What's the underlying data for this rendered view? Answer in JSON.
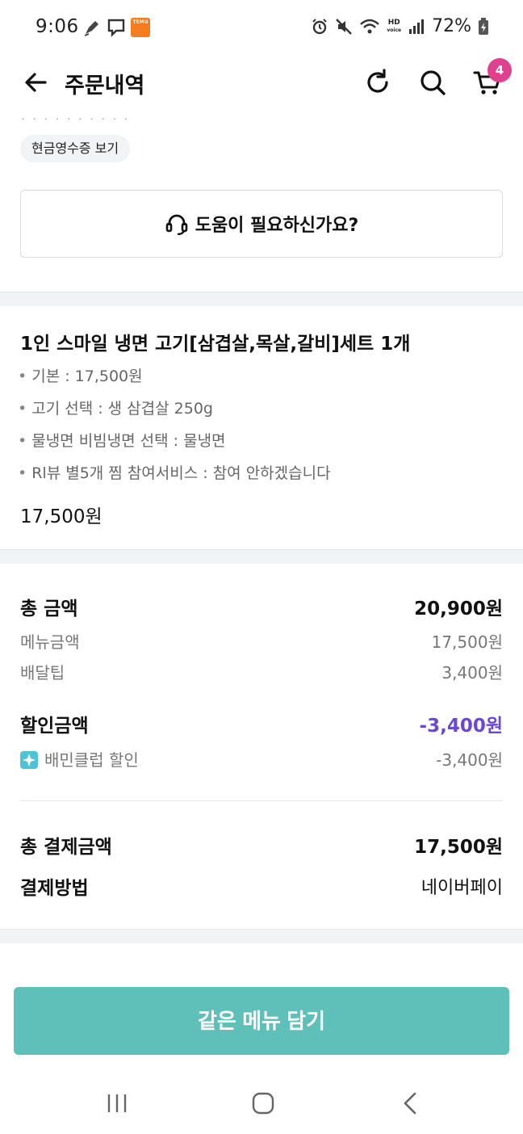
{
  "status_bar": {
    "time": "9:06",
    "battery": "72%",
    "hd_label": "HD",
    "voice_label": "voice",
    "temu_label": "TEMU"
  },
  "header": {
    "title": "주문내역",
    "cart_count": "4"
  },
  "receipt_button": "현금영수증 보기",
  "help_button": "도움이 필요하신가요?",
  "menu": {
    "title": "1인 스마일 냉면 고기[삼겹살,목살,갈비]세트 1개",
    "options": [
      "기본 : 17,500원",
      "고기 선택 : 생 삼겹살 250g",
      "물냉면 비빔냉면 선택 : 물냉면",
      "Rl뷰 별5개 찜 참여서비스 : 참여 안하겠습니다"
    ],
    "price": "17,500원"
  },
  "payment": {
    "total_label": "총 금액",
    "total_value": "20,900원",
    "menu_amount_label": "메뉴금액",
    "menu_amount_value": "17,500원",
    "delivery_tip_label": "배달팁",
    "delivery_tip_value": "3,400원",
    "discount_label": "할인금액",
    "discount_value": "-3,400원",
    "club_discount_label": "배민클럽 할인",
    "club_discount_value": "-3,400원",
    "final_label": "총 결제금액",
    "final_value": "17,500원",
    "method_label": "결제방법",
    "method_value": "네이버페이"
  },
  "cta": "같은 메뉴 담기",
  "colors": {
    "accent": "#5fbfb9",
    "discount": "#6a47d9",
    "badge": "#e0418f",
    "club_icon": "#4ec3d8"
  },
  "icons": [
    "back-arrow-icon",
    "refresh-icon",
    "search-icon",
    "cart-icon",
    "headset-icon",
    "club-star-icon",
    "recent-apps-icon",
    "home-icon",
    "back-nav-icon"
  ]
}
